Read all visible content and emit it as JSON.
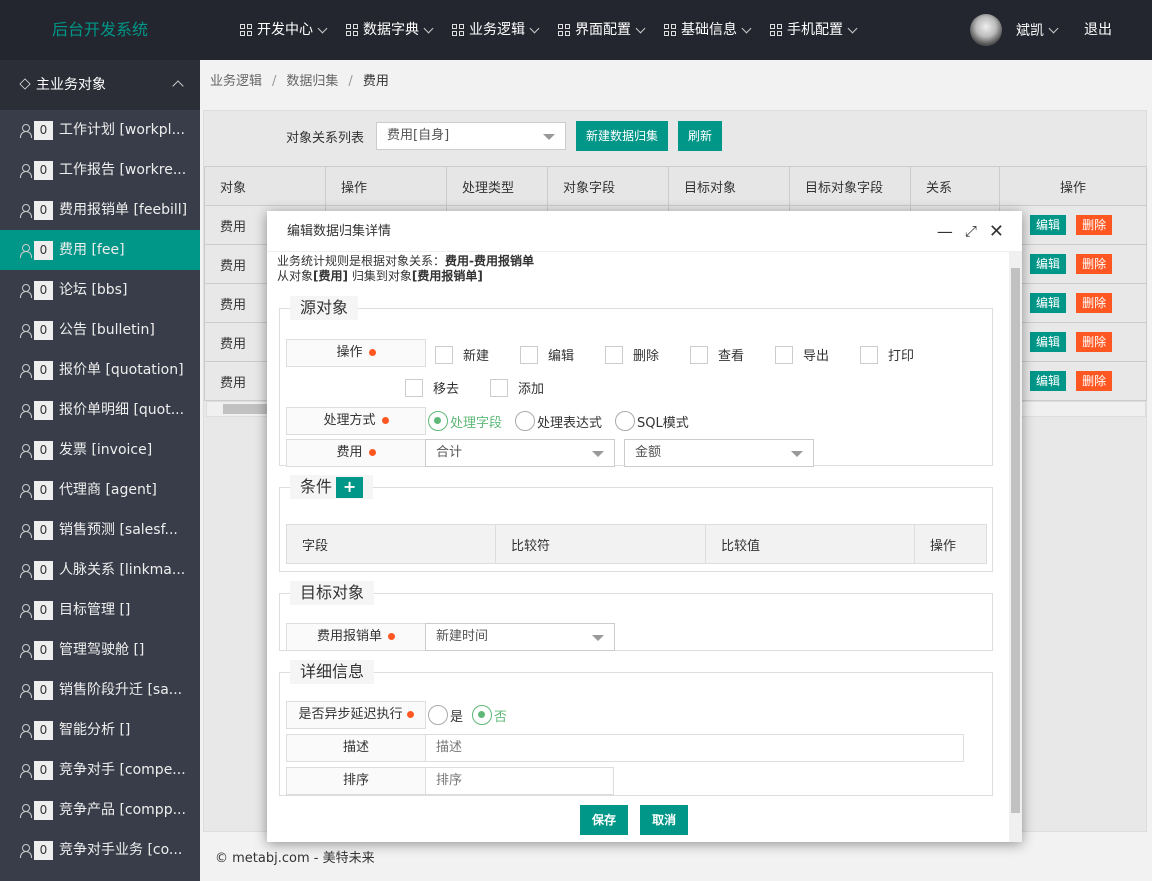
{
  "app": {
    "logo": "后台开发系统"
  },
  "topnav": [
    {
      "label": "开发中心"
    },
    {
      "label": "数据字典"
    },
    {
      "label": "业务逻辑"
    },
    {
      "label": "界面配置"
    },
    {
      "label": "基础信息"
    },
    {
      "label": "手机配置"
    }
  ],
  "user": {
    "name": "斌凯",
    "logout": "退出"
  },
  "sidebar": {
    "title": "主业务对象",
    "items": [
      {
        "count": "0",
        "label": "工作计划 [workpl..."
      },
      {
        "count": "0",
        "label": "工作报告 [workre..."
      },
      {
        "count": "0",
        "label": "费用报销单 [feebill]"
      },
      {
        "count": "0",
        "label": "费用 [fee]"
      },
      {
        "count": "0",
        "label": "论坛 [bbs]"
      },
      {
        "count": "0",
        "label": "公告 [bulletin]"
      },
      {
        "count": "0",
        "label": "报价单 [quotation]"
      },
      {
        "count": "0",
        "label": "报价单明细 [quot..."
      },
      {
        "count": "0",
        "label": "发票 [invoice]"
      },
      {
        "count": "0",
        "label": "代理商 [agent]"
      },
      {
        "count": "0",
        "label": "销售预测 [salesf..."
      },
      {
        "count": "0",
        "label": "人脉关系 [linkma..."
      },
      {
        "count": "0",
        "label": "目标管理 []"
      },
      {
        "count": "0",
        "label": "管理驾驶舱 []"
      },
      {
        "count": "0",
        "label": "销售阶段升迁 [sa..."
      },
      {
        "count": "0",
        "label": "智能分析 []"
      },
      {
        "count": "0",
        "label": "竞争对手 [compe..."
      },
      {
        "count": "0",
        "label": "竞争产品 [compp..."
      },
      {
        "count": "0",
        "label": "竞争对手业务 [co..."
      }
    ]
  },
  "breadcrumb": [
    "业务逻辑",
    "数据归集",
    "费用"
  ],
  "toolbar": {
    "label": "对象关系列表",
    "select": "费用[自身]",
    "new_btn": "新建数据归集",
    "refresh_btn": "刷新"
  },
  "table": {
    "headers": [
      "对象",
      "操作",
      "处理类型",
      "对象字段",
      "目标对象",
      "目标对象字段",
      "关系",
      "操作"
    ],
    "rows": [
      "费用",
      "费用",
      "费用",
      "费用",
      "费用"
    ],
    "edit": "编辑",
    "delete": "删除"
  },
  "footer": "© metabj.com - 美特未来",
  "modal": {
    "title": "编辑数据归集详情",
    "info_prefix": "业务统计规则是根据对象关系：",
    "info_rel": "费用-费用报销单",
    "info2_a": "从对象",
    "info2_b": "[费用]",
    "info2_c": " 归集到对象",
    "info2_d": "[费用报销单]",
    "source": {
      "legend": "源对象",
      "op_label": "操作",
      "ops": [
        "新建",
        "编辑",
        "删除",
        "查看",
        "导出",
        "打印",
        "移去",
        "添加"
      ],
      "method_label": "处理方式",
      "methods": [
        "处理字段",
        "处理表达式",
        "SQL模式"
      ],
      "field_label": "费用",
      "agg": "合计",
      "field": "金额"
    },
    "cond": {
      "legend": "条件",
      "add": "+",
      "headers": [
        "字段",
        "比较符",
        "比较值",
        "操作"
      ]
    },
    "target": {
      "legend": "目标对象",
      "label": "费用报销单",
      "value": "新建时间"
    },
    "detail": {
      "legend": "详细信息",
      "async_label": "是否异步延迟执行",
      "yes": "是",
      "no": "否",
      "desc_label": "描述",
      "desc_ph": "描述",
      "sort_label": "排序",
      "sort_ph": "排序"
    },
    "save": "保存",
    "cancel": "取消"
  }
}
